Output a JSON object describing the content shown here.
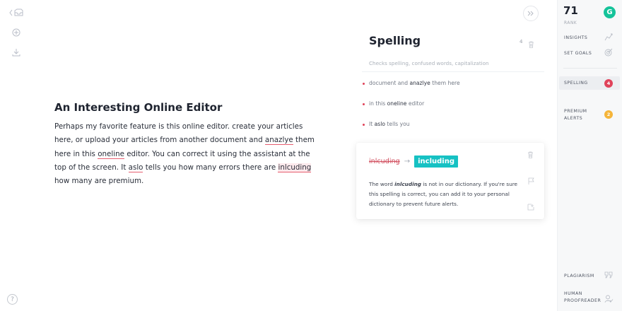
{
  "doc": {
    "title": "An Interesting Online Editor",
    "p1": "Perhaps my favorite feature is this online editor. create your articles here, or upload your articles from another document and ",
    "e1": "anazlye",
    "p2": " them here in this ",
    "e2": "oneline",
    "p3": " editor. You can correct it using the assistant at the top of the screen. It ",
    "e3": "aslo",
    "p4": " tells you how many errors there are ",
    "e4": "inlcuding",
    "p5": " how many are premium."
  },
  "panel": {
    "title": "Spelling",
    "count": "4",
    "subtitle": "Checks spelling, confused words, capitalization",
    "issues": [
      {
        "pre": "document and ",
        "word": "anazlye",
        "post": " them here"
      },
      {
        "pre": "in this ",
        "word": "oneline",
        "post": " editor"
      },
      {
        "pre": "It ",
        "word": "aslo",
        "post": " tells you"
      }
    ],
    "card": {
      "wrong": "inlcuding",
      "arrow": "→",
      "fix": "including",
      "body_pre": "The word ",
      "body_word": "inlcuding",
      "body_post": " is not in our dictionary. If you're sure this spelling is correct, you can add it to your personal dictionary to prevent future alerts."
    }
  },
  "sidebar": {
    "score": "71",
    "score_label": "RANK",
    "logo": "G",
    "insights": "INSIGHTS",
    "goals": "SET GOALS",
    "spelling": "SPELLING",
    "spelling_count": "4",
    "premium_line1": "PREMIUM",
    "premium_line2": "ALERTS",
    "premium_count": "2",
    "plagiarism": "PLAGIARISM",
    "human_line1": "HUMAN",
    "human_line2": "PROOFREADER"
  },
  "rail": {
    "help": "?"
  },
  "colors": {
    "accent": "#15c39a",
    "replacement": "#16c1c3",
    "error": "#e0435a",
    "premium": "#f5b53a"
  },
  "icons": {
    "back": "inbox-back-icon",
    "new": "plus-circle-icon",
    "download": "download-icon",
    "collapse": "double-chevron-right-icon",
    "trash": "trash-icon",
    "flag": "flag-icon",
    "dictionary": "add-to-dictionary-icon",
    "insights": "chart-line-icon",
    "goals": "target-icon",
    "plagiarism": "quote-icon",
    "proofreader": "person-check-icon"
  }
}
